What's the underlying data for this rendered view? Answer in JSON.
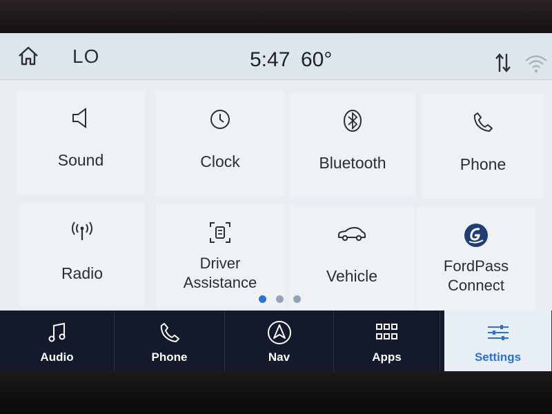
{
  "status": {
    "climate": "LO",
    "time": "5:47",
    "temperature": "60°"
  },
  "icons": {
    "home": "home-icon",
    "data": "data-transfer-icon",
    "wifi": "wifi-icon"
  },
  "tiles": [
    {
      "label": "Sound",
      "icon": "speaker-icon"
    },
    {
      "label": "Clock",
      "icon": "clock-icon"
    },
    {
      "label": "Bluetooth",
      "icon": "bluetooth-icon"
    },
    {
      "label": "Phone",
      "icon": "phone-icon"
    },
    {
      "label": "Radio",
      "icon": "radio-antenna-icon"
    },
    {
      "label": "Driver\nAssistance",
      "icon": "driver-assist-icon"
    },
    {
      "label": "Vehicle",
      "icon": "car-icon"
    },
    {
      "label": "FordPass\nConnect",
      "icon": "fordpass-icon"
    }
  ],
  "pager": {
    "pages": 3,
    "current": 1
  },
  "nav": [
    {
      "label": "Audio",
      "icon": "music-note-icon",
      "active": false
    },
    {
      "label": "Phone",
      "icon": "phone-icon",
      "active": false
    },
    {
      "label": "Nav",
      "icon": "navigation-arrow-icon",
      "active": false
    },
    {
      "label": "Apps",
      "icon": "apps-grid-icon",
      "active": false
    },
    {
      "label": "Settings",
      "icon": "sliders-icon",
      "active": true
    }
  ],
  "colors": {
    "accent": "#2d6fd6",
    "nav_background": "#141a2c",
    "screen_background": "#e9eef2"
  }
}
